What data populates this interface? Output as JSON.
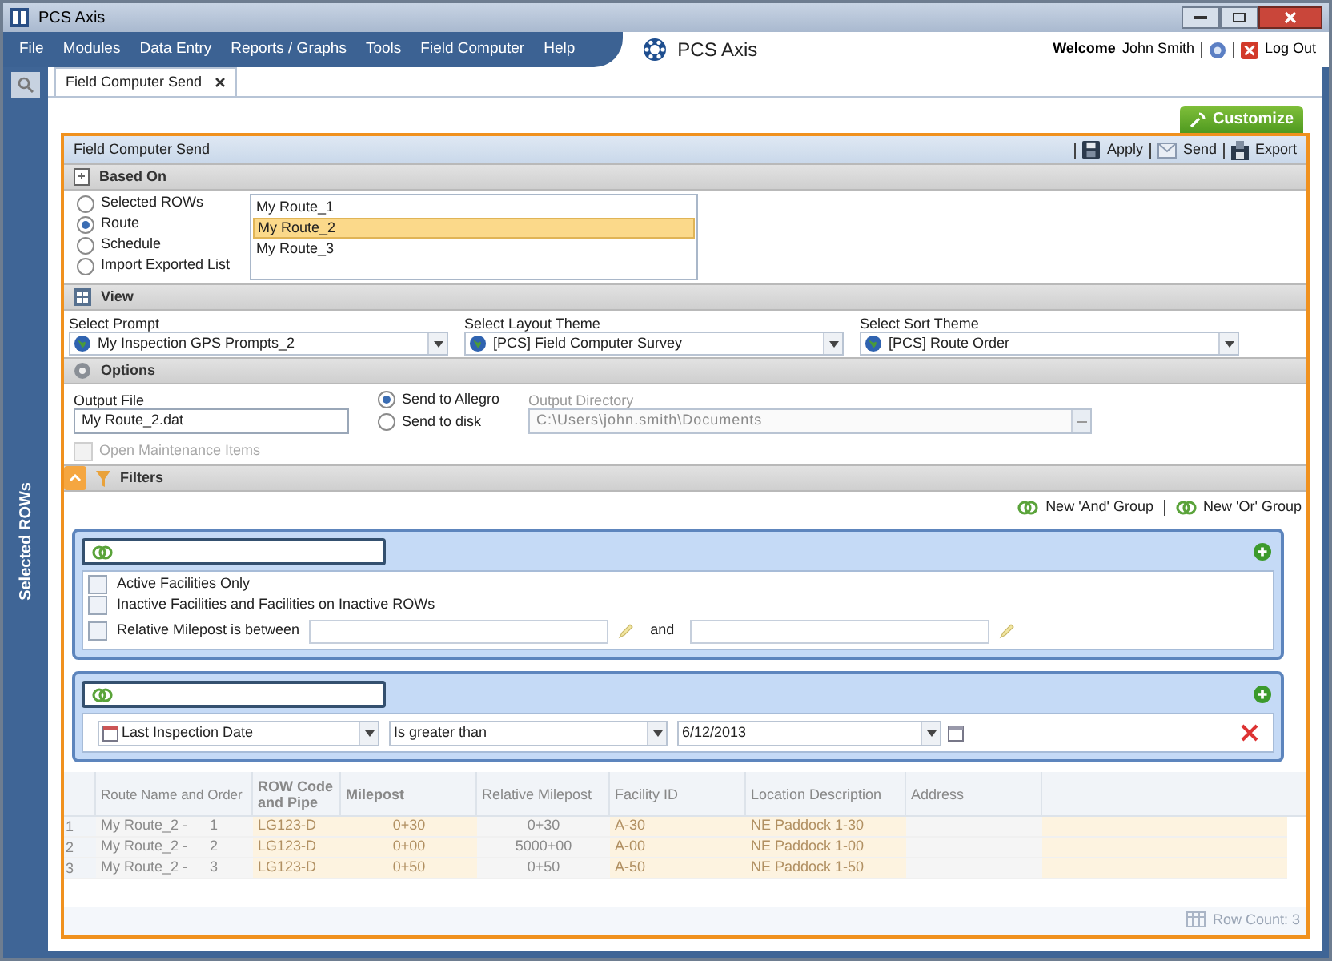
{
  "window": {
    "title": "PCS Axis"
  },
  "menu": {
    "items": [
      "File",
      "Modules",
      "Data Entry",
      "Reports / Graphs",
      "Tools",
      "Field Computer",
      "Help"
    ]
  },
  "brand": {
    "name": "PCS Axis"
  },
  "user": {
    "welcome": "Welcome",
    "name": "John Smith",
    "logout": "Log Out"
  },
  "sidebar": {
    "label": "Selected ROWs"
  },
  "tabs": [
    {
      "label": "Field Computer Send",
      "selected": true
    }
  ],
  "customize_button": "Customize",
  "panel": {
    "title": "Field Computer Send",
    "actions": [
      {
        "label": "Apply",
        "kind": "save"
      },
      {
        "label": "Send",
        "kind": "mail"
      },
      {
        "label": "Export",
        "kind": "export"
      }
    ],
    "based_on": {
      "title": "Based On",
      "options": [
        {
          "label": "Selected ROWs",
          "selected": false
        },
        {
          "label": "Route",
          "selected": true
        },
        {
          "label": "Schedule",
          "selected": false
        },
        {
          "label": "Import Exported List",
          "selected": false
        }
      ],
      "list": [
        {
          "label": "My Route_1",
          "selected": false
        },
        {
          "label": "My Route_2",
          "selected": true
        },
        {
          "label": "My Route_3",
          "selected": false
        }
      ]
    },
    "view": {
      "title": "View",
      "selects": [
        {
          "label": "Select Prompt",
          "value": "My Inspection GPS Prompts_2"
        },
        {
          "label": "Select Layout Theme",
          "value": "[PCS] Field Computer Survey"
        },
        {
          "label": "Select Sort Theme",
          "value": "[PCS] Route Order"
        }
      ]
    },
    "options": {
      "title": "Options",
      "output_file": {
        "label": "Output File",
        "value": "My Route_2.dat"
      },
      "send": [
        {
          "label": "Send to Allegro",
          "selected": true
        },
        {
          "label": "Send to disk",
          "selected": false
        }
      ],
      "output_directory": {
        "label": "Output Directory",
        "value": "C:\\Users\\john.smith\\Documents",
        "disabled": true
      },
      "open_maintenance": {
        "label": "Open Maintenance Items",
        "checked": false,
        "disabled": true
      }
    },
    "filters": {
      "title": "Filters",
      "expanded": true,
      "group_actions": [
        "New 'And' Group",
        "New 'Or' Group"
      ],
      "groups": [
        {
          "conditions": [
            {
              "kind": "check",
              "label": "Active Facilities Only",
              "checked": false
            },
            {
              "kind": "check",
              "label": "Inactive Facilities and Facilities on Inactive ROWs",
              "checked": false
            },
            {
              "kind": "range",
              "label": "Relative Milepost is between",
              "checked": false,
              "connector": "and"
            }
          ]
        },
        {
          "conditions": [
            {
              "kind": "criteria",
              "field": "Last Inspection Date",
              "operator": "Is greater than",
              "value": "6/12/2013"
            }
          ]
        }
      ]
    },
    "table": {
      "columns": [
        {
          "label": "Route Name and Order",
          "bold": false,
          "tinted": false
        },
        {
          "label": "ROW Code and Pipe",
          "bold": true,
          "tinted": true
        },
        {
          "label": "Milepost",
          "bold": true,
          "tinted": true
        },
        {
          "label": "Relative Milepost",
          "bold": false,
          "tinted": false
        },
        {
          "label": "Facility ID",
          "bold": false,
          "tinted": true
        },
        {
          "label": "Location Description",
          "bold": false,
          "tinted": true
        },
        {
          "label": "Address",
          "bold": false,
          "tinted": false
        }
      ],
      "rows": [
        {
          "number": "1",
          "cells": [
            [
              "My Route_2 -",
              "1"
            ],
            [
              "LG123-D"
            ],
            [
              "0+30"
            ],
            [
              "0+30"
            ],
            [
              "A-30"
            ],
            [
              "NE Paddock 1-30"
            ],
            []
          ]
        },
        {
          "number": "2",
          "cells": [
            [
              "My Route_2 -",
              "2"
            ],
            [
              "LG123-D"
            ],
            [
              "0+00"
            ],
            [
              "5000+00"
            ],
            [
              "A-00"
            ],
            [
              "NE Paddock 1-00"
            ],
            []
          ]
        },
        {
          "number": "3",
          "cells": [
            [
              "My Route_2 -",
              "3"
            ],
            [
              "LG123-D"
            ],
            [
              "0+50"
            ],
            [
              "0+50"
            ],
            [
              "A-50"
            ],
            [
              "NE Paddock 1-50"
            ],
            []
          ]
        }
      ],
      "row_count": "Row Count: 3"
    }
  }
}
